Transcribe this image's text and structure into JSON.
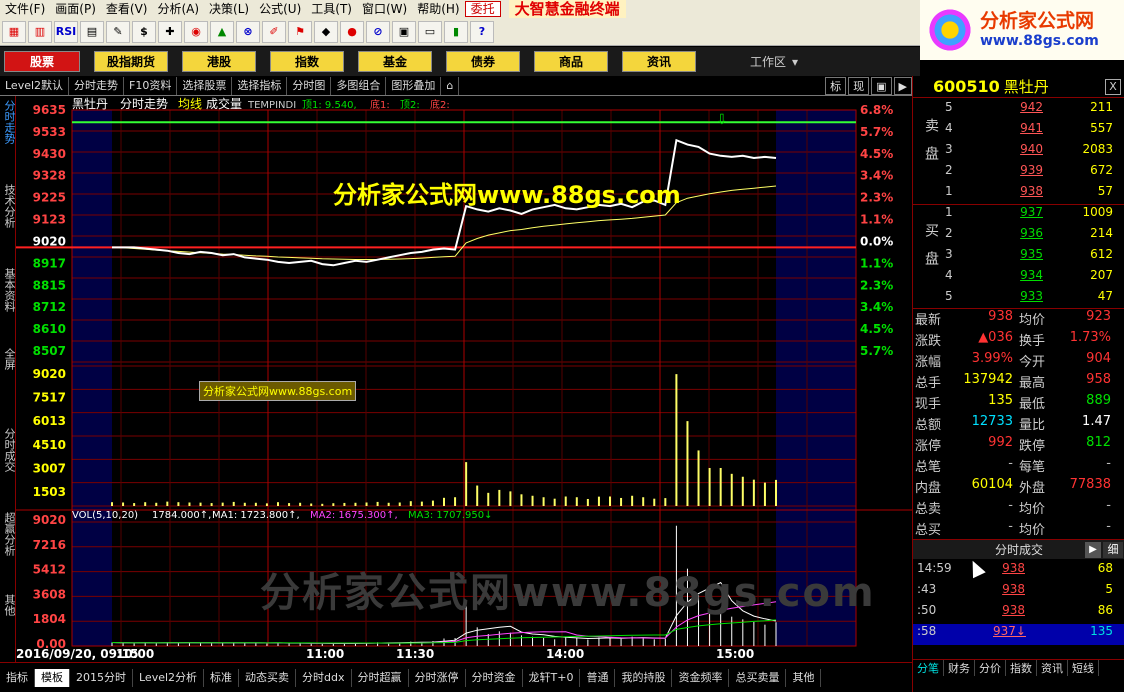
{
  "menu": {
    "items": [
      "文件(F)",
      "画面(P)",
      "查看(V)",
      "分析(A)",
      "决策(L)",
      "公式(U)",
      "工具(T)",
      "窗口(W)",
      "帮助(H)"
    ],
    "active_item": "委托",
    "brand": "大智慧金融终端"
  },
  "toolbar": {
    "rsi": "RSI",
    "dollar": "$"
  },
  "logo": {
    "title": "分析家公式网",
    "url": "www.88gs.com"
  },
  "nav": {
    "items": [
      "股票",
      "股指期货",
      "港股",
      "指数",
      "基金",
      "债券",
      "商品",
      "资讯"
    ],
    "workarea": "工作区"
  },
  "tabs": {
    "items": [
      "Level2默认",
      "分时走势",
      "F10资料",
      "选择股票",
      "选择指标",
      "分时图",
      "多图组合",
      "图形叠加"
    ],
    "right": [
      "标",
      "现"
    ]
  },
  "leftrail": [
    "分时走势",
    "技术分析",
    "基本资料",
    "全屏",
    "分时成交",
    "超赢分析",
    "其他"
  ],
  "chart_header": {
    "name": "黑牡丹",
    "tags": [
      "分时走势",
      "均线",
      "成交量"
    ],
    "formula": "TEMPINDI",
    "top1": "顶1: 9.540,",
    "bottom1": "底1:",
    "top2": "顶2:",
    "bottom2": "底2:"
  },
  "vol_header": {
    "label": "VOL(5,10,20)",
    "v": "1784.000↑,",
    "ma1": "MA1: 1723.800↑,",
    "ma2": "MA2: 1675.300↑,",
    "ma3": "MA3: 1707.950↓"
  },
  "chart_data": {
    "type": "line",
    "price_ticks": [
      "9635",
      "9533",
      "9430",
      "9328",
      "9225",
      "9123",
      "9020",
      "8917",
      "8815",
      "8712",
      "8610",
      "8507"
    ],
    "pct_ticks": [
      "6.8%",
      "5.7%",
      "4.5%",
      "3.4%",
      "2.3%",
      "1.1%",
      "0.0%",
      "1.1%",
      "2.3%",
      "3.4%",
      "4.5%",
      "5.7%"
    ],
    "volume_ticks": [
      "9020",
      "7517",
      "6013",
      "4510",
      "3007",
      "1503"
    ],
    "vol_ind_ticks": [
      "9020",
      "7216",
      "5412",
      "3608",
      "1804",
      "0.00"
    ],
    "x_labels": [
      "2016/09/20, 09:15",
      "10:00",
      "11:00",
      "11:30",
      "14:00",
      "15:00"
    ],
    "price_range": [
      8507,
      9635
    ],
    "prev_close": 9020,
    "high_line": 9580,
    "price_series": [
      9020,
      9020,
      9020,
      9015,
      9010,
      9005,
      8995,
      8990,
      9000,
      8995,
      8985,
      8990,
      8975,
      8970,
      8965,
      8955,
      8950,
      8955,
      8960,
      8945,
      8940,
      8950,
      8960,
      8955,
      8965,
      8975,
      8985,
      8995,
      9000,
      9010,
      9015,
      9010,
      9205,
      9190,
      9180,
      9195,
      9185,
      9170,
      9190,
      9200,
      9210,
      9195,
      9190,
      9200,
      9210,
      9205,
      9215,
      9200,
      9225,
      9230,
      9210,
      9500,
      9480,
      9470,
      9440,
      9430,
      9425,
      9430,
      9420,
      9425,
      9420
    ],
    "avg_series": [
      9020,
      9018,
      9015,
      9012,
      9008,
      9005,
      9002,
      8999,
      8996,
      8993,
      8990,
      8988,
      8985,
      8982,
      8980,
      8977,
      8975,
      8973,
      8971,
      8969,
      8968,
      8967,
      8966,
      8966,
      8966,
      8967,
      8968,
      8970,
      8972,
      8975,
      8978,
      8980,
      9040,
      9060,
      9075,
      9085,
      9095,
      9100,
      9108,
      9115,
      9120,
      9125,
      9130,
      9135,
      9140,
      9143,
      9146,
      9150,
      9155,
      9160,
      9165,
      9220,
      9240,
      9250,
      9260,
      9268,
      9275,
      9280,
      9285,
      9290,
      9295
    ],
    "volume_series": [
      260,
      240,
      200,
      260,
      220,
      300,
      260,
      240,
      230,
      200,
      230,
      280,
      220,
      220,
      180,
      260,
      200,
      220,
      170,
      150,
      190,
      210,
      220,
      240,
      280,
      220,
      240,
      330,
      300,
      370,
      560,
      600,
      3000,
      1400,
      900,
      1100,
      1000,
      800,
      700,
      600,
      500,
      650,
      600,
      480,
      640,
      650,
      550,
      700,
      600,
      500,
      540,
      9020,
      5800,
      3800,
      2600,
      2600,
      2200,
      2000,
      1800,
      1600,
      1784
    ]
  },
  "panel": {
    "code": "600510",
    "name": "黑牡丹",
    "close": "X",
    "sell_label": "卖盘",
    "buy_label": "买盘",
    "asks": [
      {
        "lv": "5",
        "p": "942",
        "v": "211"
      },
      {
        "lv": "4",
        "p": "941",
        "v": "557"
      },
      {
        "lv": "3",
        "p": "940",
        "v": "2083"
      },
      {
        "lv": "2",
        "p": "939",
        "v": "672"
      },
      {
        "lv": "1",
        "p": "938",
        "v": "57"
      }
    ],
    "bids": [
      {
        "lv": "1",
        "p": "937",
        "v": "1009"
      },
      {
        "lv": "2",
        "p": "936",
        "v": "214"
      },
      {
        "lv": "3",
        "p": "935",
        "v": "612"
      },
      {
        "lv": "4",
        "p": "934",
        "v": "207"
      },
      {
        "lv": "5",
        "p": "933",
        "v": "47"
      }
    ],
    "quote": [
      [
        "最新",
        "938",
        "均价",
        "923"
      ],
      [
        "涨跌",
        "▲036",
        "换手",
        "1.73%"
      ],
      [
        "涨幅",
        "3.99%",
        "今开",
        "904"
      ],
      [
        "总手",
        "137942",
        "最高",
        "958"
      ],
      [
        "现手",
        "135",
        "最低",
        "889"
      ],
      [
        "总额",
        "12733",
        "量比",
        "1.47"
      ],
      [
        "涨停",
        "992",
        "跌停",
        "812"
      ],
      [
        "总笔",
        "-",
        "每笔",
        "-"
      ],
      [
        "内盘",
        "60104",
        "外盘",
        "77838"
      ],
      [
        "总卖",
        "-",
        "均价",
        "-"
      ],
      [
        "总买",
        "-",
        "均价",
        "-"
      ]
    ],
    "tick_title": "分时成交",
    "tick_more": "细",
    "tick_arrow": "▶",
    "ticks": [
      {
        "t": "14:59",
        "p": "938",
        "v": "68"
      },
      {
        "t": ":43",
        "p": "938",
        "v": "5"
      },
      {
        "t": ":50",
        "p": "938",
        "v": "86"
      },
      {
        "t": ":58",
        "p": "937↓",
        "v": "135"
      }
    ],
    "tabs": [
      "分笔",
      "财务",
      "分价",
      "指数",
      "资讯",
      "短线"
    ]
  },
  "bottom": {
    "items": [
      "指标",
      "模板",
      "2015分时",
      "Level2分析",
      "标准",
      "动态买卖",
      "分时ddx",
      "分时超赢",
      "分时涨停",
      "分时资金",
      "龙轩T+0",
      "普通",
      "我的持股",
      "资金频率",
      "总买卖量",
      "其他"
    ]
  },
  "watermarks": {
    "big": "分析家公式网www.88gs.com",
    "small": "分析家公式网www.88gs.com",
    "faint": "分析家公式网www.88gs.com"
  }
}
